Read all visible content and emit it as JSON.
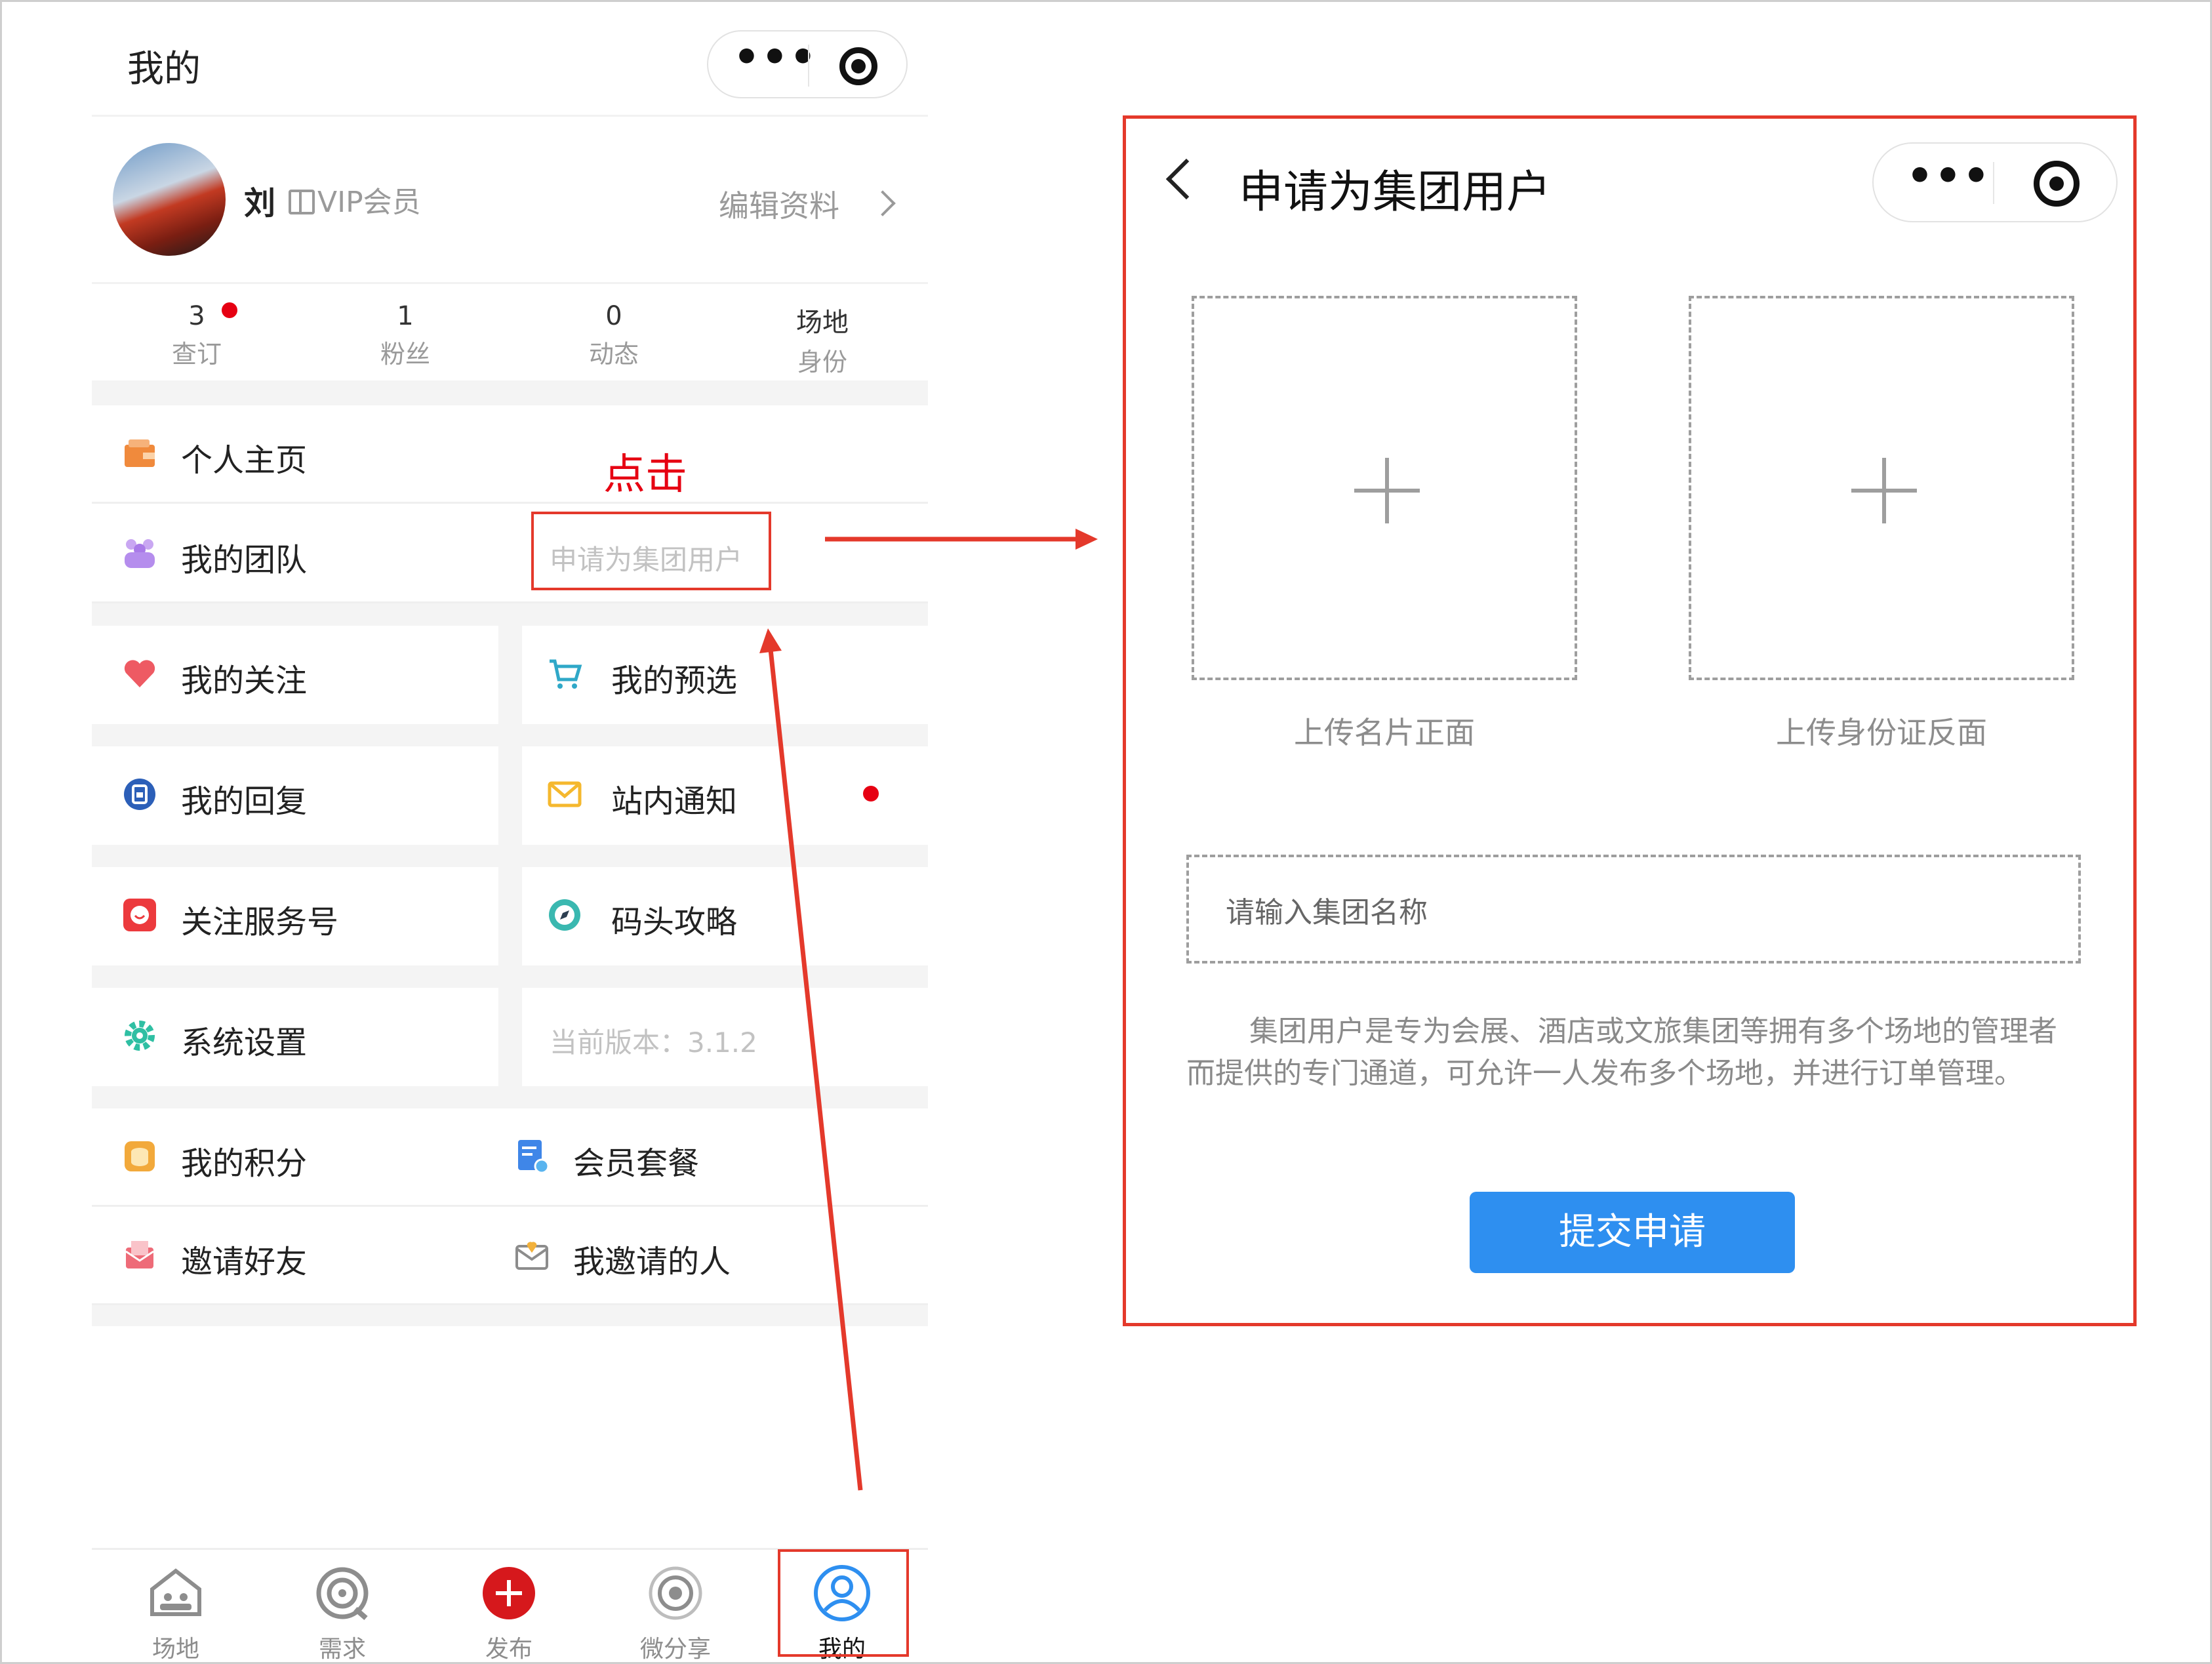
{
  "left": {
    "page_title": "我的",
    "user": {
      "name": "刘",
      "vip": "VIP会员",
      "edit": "编辑资料"
    },
    "stats": [
      {
        "num": "3",
        "label": "查订"
      },
      {
        "num": "1",
        "label": "粉丝"
      },
      {
        "num": "0",
        "label": "动态"
      },
      {
        "num": "场地",
        "label": "身份"
      }
    ],
    "menu": {
      "personal_home": "个人主页",
      "my_team": "我的团队",
      "apply_group": "申请为集团用户",
      "my_follow": "我的关注",
      "my_preselect": "我的预选",
      "my_reply": "我的回复",
      "notice": "站内通知",
      "follow_service": "关注服务号",
      "dock_guide": "码头攻略",
      "settings": "系统设置",
      "version": "当前版本：3.1.2",
      "points": "我的积分",
      "member_plan": "会员套餐",
      "invite": "邀请好友",
      "invited": "我邀请的人"
    },
    "annotation": "点击",
    "tabs": [
      "场地",
      "需求",
      "发布",
      "微分享",
      "我的"
    ]
  },
  "right": {
    "title": "申请为集团用户",
    "upload_front": "上传名片正面",
    "upload_back": "上传身份证反面",
    "group_placeholder": "请输入集团名称",
    "description": "集团用户是专为会展、酒店或文旅集团等拥有多个场地的管理者而提供的专门通道，可允许一人发布多个场地，并进行订单管理。",
    "submit": "提交申请"
  },
  "colors": {
    "accent_red": "#e4392b",
    "button_blue": "#2e8ff0",
    "dot_red": "#e60012"
  }
}
